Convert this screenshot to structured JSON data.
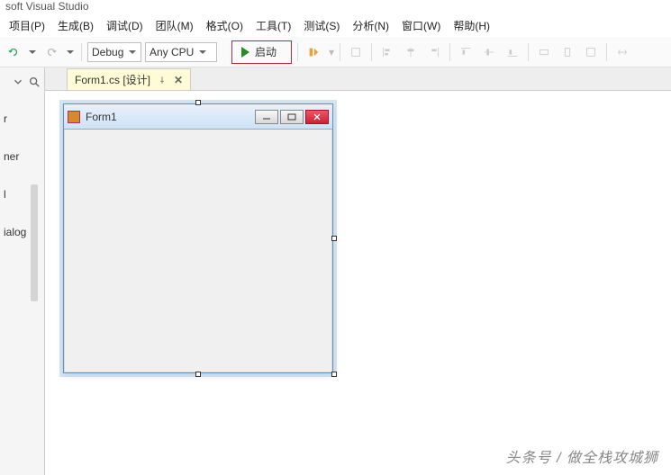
{
  "titlebar": "soft Visual Studio",
  "menu": {
    "project": "项目(P)",
    "build": "生成(B)",
    "debug": "调试(D)",
    "team": "团队(M)",
    "format": "格式(O)",
    "tools": "工具(T)",
    "test": "测试(S)",
    "analyze": "分析(N)",
    "window": "窗口(W)",
    "help": "帮助(H)"
  },
  "toolbar": {
    "config": "Debug",
    "platform": "Any CPU",
    "start_label": "启动"
  },
  "side": {
    "item1": "r",
    "item2": "ner",
    "item3": "l",
    "item4": "ialog"
  },
  "tab": {
    "label": "Form1.cs [设计]",
    "close": "✕"
  },
  "form": {
    "title": "Form1"
  },
  "watermark": "头条号 / 做全栈攻城狮"
}
